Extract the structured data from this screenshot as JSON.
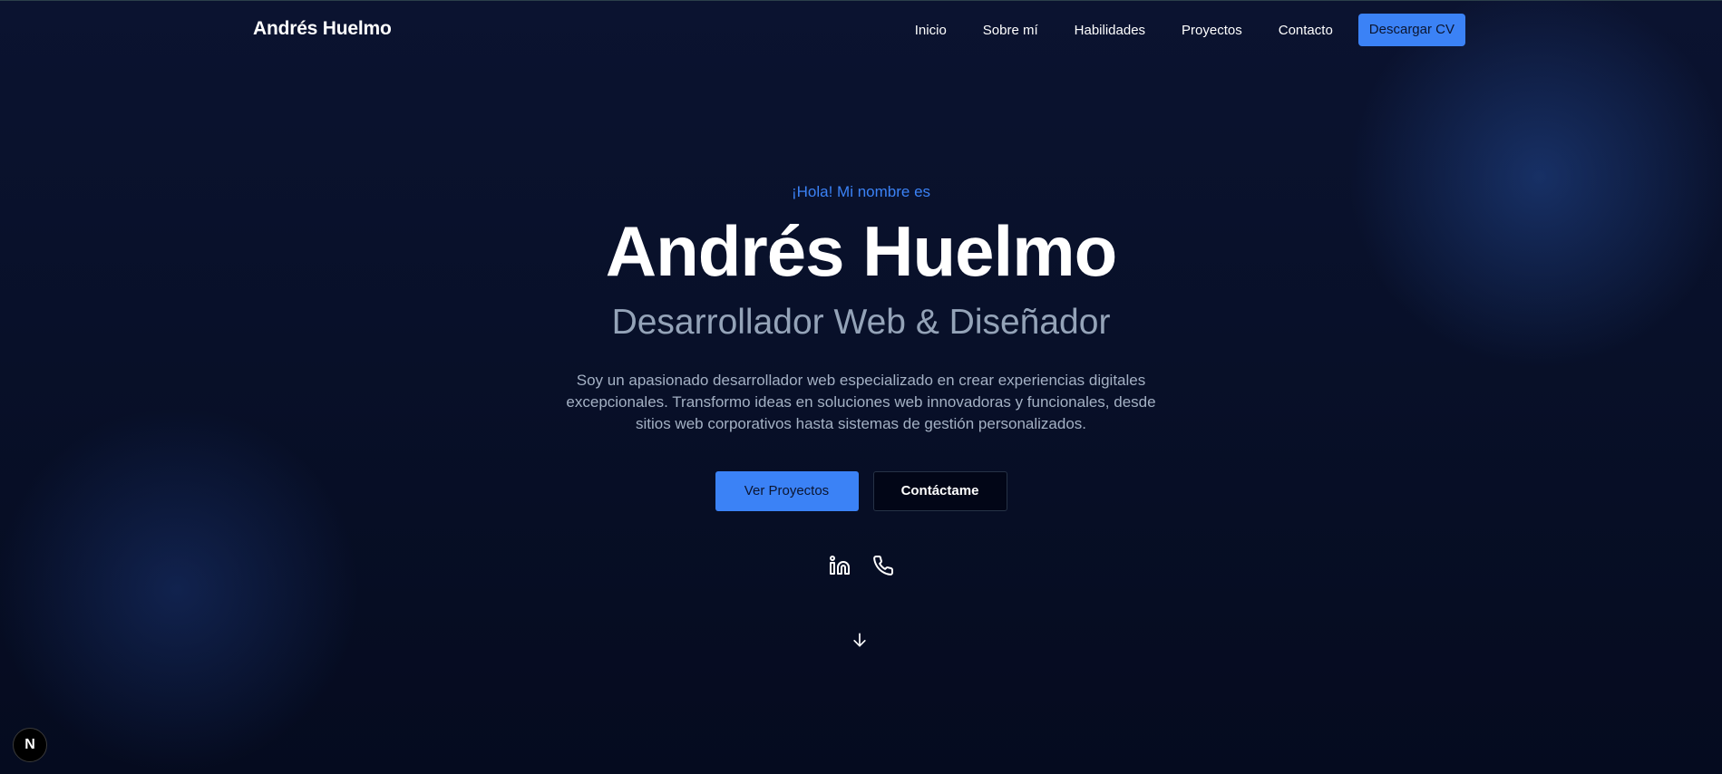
{
  "header": {
    "brand": "Andrés Huelmo",
    "nav": {
      "inicio": "Inicio",
      "sobre_mi": "Sobre mí",
      "habilidades": "Habilidades",
      "proyectos": "Proyectos",
      "contacto": "Contacto"
    },
    "cv_button": "Descargar CV"
  },
  "hero": {
    "greeting": "¡Hola! Mi nombre es",
    "name": "Andrés Huelmo",
    "role": "Desarrollador Web & Diseñador",
    "bio": "Soy un apasionado desarrollador web especializado en crear experiencias digitales excepcionales. Transformo ideas en soluciones web innovadoras y funcionales, desde sitios web corporativos hasta sistemas de gestión personalizados.",
    "primary_button": "Ver Proyectos",
    "secondary_button": "Contáctame"
  },
  "socials": {
    "items": [
      {
        "icon": "linkedin-icon"
      },
      {
        "icon": "phone-icon"
      }
    ]
  },
  "scroll": {
    "icon": "arrow-down-icon"
  },
  "dev_badge": {
    "label": "N",
    "icon": "nextjs-icon"
  },
  "colors": {
    "accent": "#3b82f6",
    "background": "#081029",
    "muted_text": "#94a3b8",
    "bio_text": "#a4b1c4"
  }
}
